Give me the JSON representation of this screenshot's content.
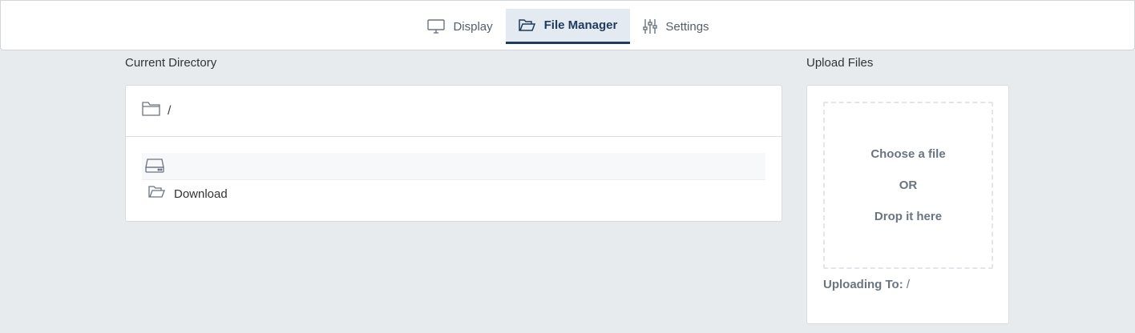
{
  "tabs": [
    {
      "label": "Display",
      "icon": "monitor-icon",
      "active": false
    },
    {
      "label": "File Manager",
      "icon": "folder-open-icon",
      "active": true
    },
    {
      "label": "Settings",
      "icon": "sliders-icon",
      "active": false
    }
  ],
  "current_directory": {
    "title": "Current Directory",
    "path": "/",
    "entries": [
      {
        "name": "",
        "icon": "drive-icon"
      },
      {
        "name": "Download",
        "icon": "folder-open-icon"
      }
    ]
  },
  "upload": {
    "title": "Upload Files",
    "choose_label": "Choose a file",
    "or_label": "OR",
    "drop_label": "Drop it here",
    "uploading_label": "Uploading To:",
    "uploading_path": "/"
  },
  "colors": {
    "background": "#e8ebee",
    "active_tab_bg": "#e4eaf2",
    "active_tab_text": "#1f3a5a",
    "muted_text": "#6b7580"
  }
}
